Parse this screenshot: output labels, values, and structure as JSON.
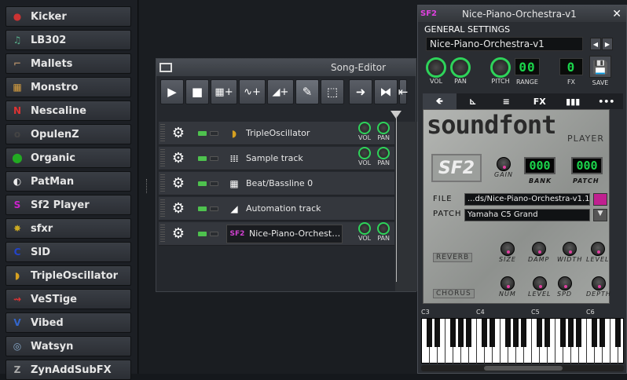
{
  "sidebar": {
    "items": [
      {
        "label": "Kicker",
        "icon": "kicker-icon"
      },
      {
        "label": "LB302",
        "icon": "lb302-icon"
      },
      {
        "label": "Mallets",
        "icon": "mallets-icon"
      },
      {
        "label": "Monstro",
        "icon": "monstro-icon"
      },
      {
        "label": "Nescaline",
        "icon": "nescaline-icon"
      },
      {
        "label": "OpulenZ",
        "icon": "opulenz-icon"
      },
      {
        "label": "Organic",
        "icon": "organic-icon"
      },
      {
        "label": "PatMan",
        "icon": "patman-icon"
      },
      {
        "label": "Sf2 Player",
        "icon": "sf2-icon"
      },
      {
        "label": "sfxr",
        "icon": "sfxr-icon"
      },
      {
        "label": "SID",
        "icon": "sid-icon"
      },
      {
        "label": "TripleOscillator",
        "icon": "tripleoscillator-icon"
      },
      {
        "label": "VeSTige",
        "icon": "vestige-icon"
      },
      {
        "label": "Vibed",
        "icon": "vibed-icon"
      },
      {
        "label": "Watsyn",
        "icon": "watsyn-icon"
      },
      {
        "label": "ZynAddSubFX",
        "icon": "zynaddsubfx-icon"
      }
    ]
  },
  "song_editor": {
    "title": "Song-Editor",
    "tracks": [
      {
        "name": "TripleOscillator",
        "icon": "tripleoscillator-icon",
        "knobs": true
      },
      {
        "name": "Sample track",
        "icon": "waveform-icon",
        "knobs": true
      },
      {
        "name": "Beat/Bassline 0",
        "icon": "grid-icon",
        "knobs": false
      },
      {
        "name": "Automation track",
        "icon": "ramp-icon",
        "knobs": false
      },
      {
        "name": "Nice-Piano-Orchest…",
        "icon": "sf2-icon",
        "knobs": true
      }
    ],
    "vol_label": "VOL",
    "pan_label": "PAN"
  },
  "sf2_window": {
    "title": "Nice-Piano-Orchestra-v1",
    "general_settings": "GENERAL SETTINGS",
    "preset_name": "Nice-Piano-Orchestra-v1",
    "knob_labels": {
      "vol": "VOL",
      "pan": "PAN",
      "pitch": "PITCH",
      "range": "RANGE",
      "fx": "FX",
      "save": "SAVE"
    },
    "range_value": "00",
    "fx_value": "0",
    "brand_title": "soundfont",
    "brand_subtitle": "PLAYER",
    "gain_label": "GAIN",
    "bank_label": "BANK",
    "bank_value": "000",
    "patch_label": "PATCH",
    "patch_value": "000",
    "file_label": "FILE",
    "file_value": "...ds/Nice-Piano-Orchestra-v1.1",
    "patch_row_label": "PATCH",
    "patch_row_value": "Yamaha C5 Grand",
    "reverb_label": "REVERB",
    "reverb_knobs": [
      "SIZE",
      "DAMP",
      "WIDTH",
      "LEVEL"
    ],
    "chorus_label": "CHORUS",
    "chorus_knobs": [
      "NUM",
      "LEVEL",
      "SPD",
      "DEPTH"
    ],
    "piano_labels": [
      "C3",
      "C4",
      "C5",
      "C6"
    ]
  }
}
